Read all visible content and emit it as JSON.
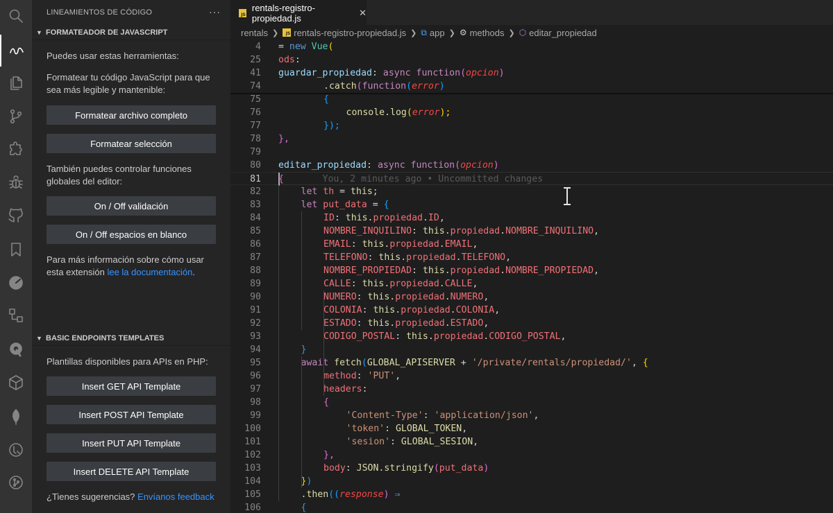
{
  "activity_bar": {
    "icons": [
      "search-icon",
      "source-icon",
      "files-icon",
      "git-icon",
      "extensions-icon",
      "debug-icon",
      "github-icon",
      "bookmark-icon",
      "gauge-icon",
      "remote-icon",
      "rocket-icon",
      "package-icon",
      "leaf-icon",
      "tools-icon",
      "git-graph-icon"
    ]
  },
  "sidebar": {
    "title": "LINEAMIENTOS DE CÓDIGO",
    "more": "···",
    "section1": {
      "title": "FORMATEADOR DE JAVASCRIPT",
      "intro": "Puedes usar estas herramientas:",
      "desc": "Formatear tu código JavaScript para que sea más legible y mantenible:",
      "btn_format_file": "Formatear archivo completo",
      "btn_format_selection": "Formatear selección",
      "desc2": "También puedes controlar funciones globales del editor:",
      "btn_validation": "On / Off validación",
      "btn_whitespace": "On / Off espacios en blanco",
      "more_info": "Para más información sobre cómo usar esta extensión ",
      "doc_link": "lee la documentación",
      "period": "."
    },
    "section2": {
      "title": "BASIC ENDPOINTS TEMPLATES",
      "desc": "Plantillas disponibles para APIs en PHP:",
      "btn_get": "Insert GET API Template",
      "btn_post": "Insert POST API Template",
      "btn_put": "Insert PUT API Template",
      "btn_delete": "Insert DELETE API Template",
      "suggest": "¿Tienes sugerencias? ",
      "feedback_link": "Envíanos feedback"
    }
  },
  "editor": {
    "tab": {
      "badge": "JS",
      "label": "rentals-registro-propiedad.js",
      "close": "✕"
    },
    "breadcrumb": [
      "rentals",
      "rentals-registro-propiedad.js",
      "app",
      "methods",
      "editar_propiedad"
    ],
    "blame": "You, 2 minutes ago • Uncommitted changes",
    "current_line": "81",
    "line_numbers": [
      "4",
      "25",
      "41",
      "74",
      "75",
      "76",
      "77",
      "78",
      "79",
      "80",
      "81",
      "82",
      "83",
      "84",
      "85",
      "86",
      "87",
      "88",
      "89",
      "90",
      "91",
      "92",
      "93",
      "94",
      "95",
      "96",
      "97",
      "98",
      "99",
      "100",
      "101",
      "102",
      "103",
      "104",
      "105",
      "106"
    ],
    "code": {
      "l4": [
        "= ",
        "new",
        " ",
        "Vue",
        "("
      ],
      "l25": [
        "ods",
        ":"
      ],
      "l41": [
        "guardar_propiedad",
        ": ",
        "async",
        " ",
        "function",
        "(",
        "opcion",
        ")"
      ],
      "l74": [
        ".",
        "catch",
        "(",
        "function",
        "(",
        "error",
        ")"
      ],
      "l75": [
        "{"
      ],
      "l76": [
        "console",
        ".",
        "log",
        "(",
        "error",
        ");"
      ],
      "l77": [
        "});"
      ],
      "l78": [
        "},"
      ],
      "l80": [
        "editar_propiedad",
        ": ",
        "async",
        " ",
        "function",
        "(",
        "opcion",
        ")"
      ],
      "l81": [
        "{"
      ],
      "l82": [
        "let",
        " ",
        "th",
        " = ",
        "this",
        ";"
      ],
      "l83": [
        "let",
        " ",
        "put_data",
        " = ",
        "{"
      ],
      "props": [
        [
          "ID",
          "ID"
        ],
        [
          "NOMBRE_INQUILINO",
          "NOMBRE_INQUILINO"
        ],
        [
          "EMAIL",
          "EMAIL"
        ],
        [
          "TELEFONO",
          "TELEFONO"
        ],
        [
          "NOMBRE_PROPIEDAD",
          "NOMBRE_PROPIEDAD"
        ],
        [
          "CALLE",
          "CALLE"
        ],
        [
          "NUMERO",
          "NUMERO"
        ],
        [
          "COLONIA",
          "COLONIA"
        ],
        [
          "ESTADO",
          "ESTADO"
        ],
        [
          "CODIGO_POSTAL",
          "CODIGO_POSTAL"
        ]
      ],
      "this_kw": "this",
      "propiedad": "propiedad",
      "l94": [
        "}"
      ],
      "l95": [
        "await",
        " ",
        "fetch",
        "(",
        "GLOBAL_APISERVER",
        " + ",
        "'/private/rentals/propiedad/'",
        ", ",
        "{"
      ],
      "l96": [
        "method",
        ": ",
        "'PUT'",
        ","
      ],
      "l97": [
        "headers",
        ":"
      ],
      "l98": [
        "{"
      ],
      "l99": [
        "'Content-Type'",
        ": ",
        "'application/json'",
        ","
      ],
      "l100": [
        "'token'",
        ": ",
        "GLOBAL_TOKEN",
        ","
      ],
      "l101": [
        "'sesion'",
        ": ",
        "GLOBAL_SESION",
        ","
      ],
      "l102": [
        "},"
      ],
      "l103": [
        "body",
        ": ",
        "JSON",
        ".",
        "stringify",
        "(",
        "put_data",
        ")"
      ],
      "l104": [
        "})"
      ],
      "l105": [
        ".",
        "then",
        "((",
        "response",
        ") ",
        "⇒"
      ],
      "l106": [
        "{"
      ]
    }
  }
}
